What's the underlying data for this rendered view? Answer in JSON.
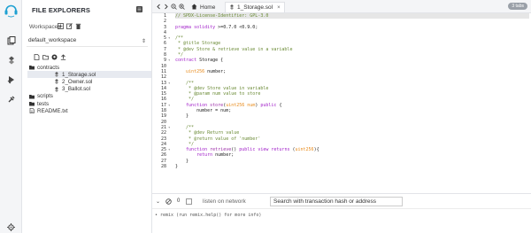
{
  "explorer": {
    "title": "FILE EXPLORERS",
    "workspaces_label": "Workspaces",
    "workspace_selected": "default_workspace",
    "tree": [
      {
        "label": "contracts",
        "type": "folder",
        "level": 1
      },
      {
        "label": "1_Storage.sol",
        "type": "file",
        "level": 2,
        "selected": true
      },
      {
        "label": "2_Owner.sol",
        "type": "file",
        "level": 2
      },
      {
        "label": "3_Ballot.sol",
        "type": "file",
        "level": 2
      },
      {
        "label": "scripts",
        "type": "folder",
        "level": 1
      },
      {
        "label": "tests",
        "type": "folder",
        "level": 1
      },
      {
        "label": "README.txt",
        "type": "file-text",
        "level": 1
      }
    ]
  },
  "tabs": {
    "home_label": "Home",
    "file_label": "1_Storage.sol",
    "close_glyph": "×",
    "badge": "3 tabs"
  },
  "editor": {
    "lines": [
      {
        "n": "1",
        "parts": [
          [
            "// SPDX-License-Identifier: GPL-3.0",
            "c-com"
          ]
        ],
        "hl": true
      },
      {
        "n": "2",
        "parts": []
      },
      {
        "n": "3",
        "parts": [
          [
            "pragma solidity ",
            "c-kw"
          ],
          [
            ">=0.7.0 <0.9.0;",
            "c-tx"
          ]
        ]
      },
      {
        "n": "4",
        "parts": []
      },
      {
        "n": "5",
        "parts": [
          [
            "/**",
            "c-com"
          ]
        ],
        "fold": true
      },
      {
        "n": "6",
        "parts": [
          [
            " * @title Storage",
            "c-com"
          ]
        ]
      },
      {
        "n": "7",
        "parts": [
          [
            " * @dev Store & retrieve value in a variable",
            "c-com"
          ]
        ]
      },
      {
        "n": "8",
        "parts": [
          [
            " */",
            "c-com"
          ]
        ]
      },
      {
        "n": "9",
        "parts": [
          [
            "contract ",
            "c-kw"
          ],
          [
            "Storage {",
            "c-tx"
          ]
        ],
        "fold": true
      },
      {
        "n": "10",
        "parts": []
      },
      {
        "n": "11",
        "parts": [
          [
            "    uint256 ",
            "c-ty"
          ],
          [
            "number;",
            "c-tx"
          ]
        ]
      },
      {
        "n": "12",
        "parts": []
      },
      {
        "n": "13",
        "parts": [
          [
            "    /**",
            "c-com"
          ]
        ],
        "fold": true
      },
      {
        "n": "14",
        "parts": [
          [
            "     * @dev Store value in variable",
            "c-com"
          ]
        ]
      },
      {
        "n": "15",
        "parts": [
          [
            "     * @param num value to store",
            "c-com"
          ]
        ]
      },
      {
        "n": "16",
        "parts": [
          [
            "     */",
            "c-com"
          ]
        ]
      },
      {
        "n": "17",
        "parts": [
          [
            "    function ",
            "c-kw"
          ],
          [
            "store",
            "c-fn"
          ],
          [
            "(",
            "c-tx"
          ],
          [
            "uint256 num",
            "c-ty"
          ],
          [
            ") ",
            "c-tx"
          ],
          [
            "public",
            "c-kw"
          ],
          [
            " {",
            "c-tx"
          ]
        ],
        "fold": true
      },
      {
        "n": "18",
        "parts": [
          [
            "        number = num;",
            "c-tx"
          ]
        ]
      },
      {
        "n": "19",
        "parts": [
          [
            "    }",
            "c-tx"
          ]
        ]
      },
      {
        "n": "20",
        "parts": []
      },
      {
        "n": "21",
        "parts": [
          [
            "    /**",
            "c-com"
          ]
        ],
        "fold": true
      },
      {
        "n": "22",
        "parts": [
          [
            "     * @dev Return value",
            "c-com"
          ]
        ]
      },
      {
        "n": "23",
        "parts": [
          [
            "     * @return value of 'number'",
            "c-com"
          ]
        ]
      },
      {
        "n": "24",
        "parts": [
          [
            "     */",
            "c-com"
          ]
        ]
      },
      {
        "n": "25",
        "parts": [
          [
            "    function ",
            "c-kw"
          ],
          [
            "retrieve",
            "c-fn"
          ],
          [
            "() ",
            "c-tx"
          ],
          [
            "public view returns ",
            "c-kw"
          ],
          [
            "(",
            "c-tx"
          ],
          [
            "uint256",
            "c-ty"
          ],
          [
            "){",
            "c-tx"
          ]
        ],
        "fold": true
      },
      {
        "n": "26",
        "parts": [
          [
            "        return ",
            "c-kw"
          ],
          [
            "number;",
            "c-tx"
          ]
        ]
      },
      {
        "n": "27",
        "parts": [
          [
            "    }",
            "c-tx"
          ]
        ]
      },
      {
        "n": "28",
        "parts": [
          [
            "}",
            "c-tx"
          ]
        ]
      }
    ]
  },
  "terminal": {
    "count": "0",
    "listen_label": "listen on network",
    "search_placeholder": "Search with transaction hash or address",
    "log_line": "• remix (run remix.help() for more info)"
  },
  "colors": {
    "accent": "#1ea0d2",
    "comment": "#6a8a35",
    "keyword": "#a11fc9",
    "type": "#e88a1a"
  }
}
